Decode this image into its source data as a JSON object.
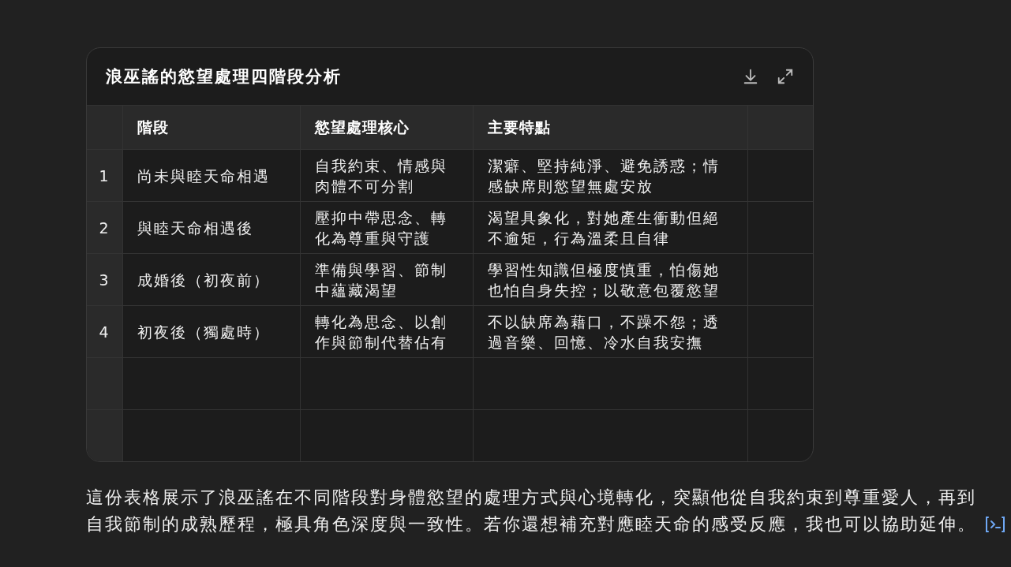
{
  "table_card": {
    "title": "浪巫謠的慾望處理四階段分析",
    "columns": [
      "階段",
      "慾望處理核心",
      "主要特點"
    ],
    "rows": [
      {
        "index": "1",
        "cells": [
          "尚未與睦天命相遇",
          "自我約束、情感與肉體不可分割",
          "潔癖、堅持純淨、避免誘惑；情感缺席則慾望無處安放"
        ]
      },
      {
        "index": "2",
        "cells": [
          "與睦天命相遇後",
          "壓抑中帶思念、轉化為尊重與守護",
          "渴望具象化，對她產生衝動但絕不逾矩，行為溫柔且自律"
        ]
      },
      {
        "index": "3",
        "cells": [
          "成婚後（初夜前）",
          "準備與學習、節制中蘊藏渴望",
          "學習性知識但極度慎重，怕傷她也怕自身失控；以敬意包覆慾望"
        ]
      },
      {
        "index": "4",
        "cells": [
          "初夜後（獨處時）",
          "轉化為思念、以創作與節制代替佔有",
          "不以缺席為藉口，不躁不怨；透過音樂、回憶、冷水自我安撫"
        ]
      }
    ]
  },
  "paragraph": "這份表格展示了浪巫謠在不同階段對身體慾望的處理方式與心境轉化，突顯他從自我約束到尊重愛人，再到自我節制的成熟歷程，極具角色深度與一致性。若你還想補充對應睦天命的感受反應，我也可以協助延伸。"
}
